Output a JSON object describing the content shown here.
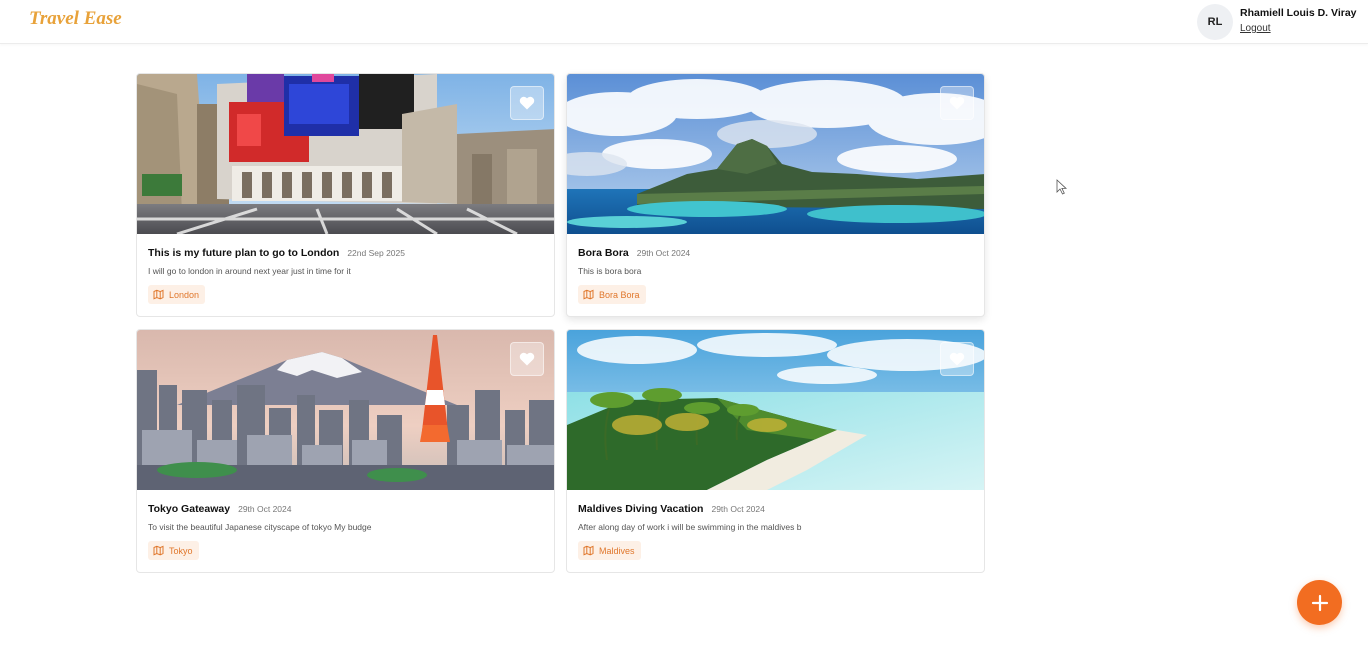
{
  "app": {
    "name": "Travel Ease"
  },
  "user": {
    "initials": "RL",
    "name": "Rhamiell Louis D. Viray",
    "logout_label": "Logout"
  },
  "stories": [
    {
      "title": "This is my future plan to go to London",
      "date": "22nd Sep 2025",
      "description": "I will go to london in around next year just in time for it",
      "location": "London",
      "image_icon": "london-street-photo"
    },
    {
      "title": "Bora Bora",
      "date": "29th Oct 2024",
      "description": "This is bora bora",
      "location": "Bora Bora",
      "image_icon": "bora-bora-island-photo"
    },
    {
      "title": "Tokyo Gateaway",
      "date": "29th Oct 2024",
      "description": "To visit the beautiful Japanese cityscape of tokyo My budge",
      "location": "Tokyo",
      "image_icon": "tokyo-skyline-photo"
    },
    {
      "title": "Maldives Diving Vacation",
      "date": "29th Oct 2024",
      "description": "After along day of work i will be swimming in the maldives b",
      "location": "Maldives",
      "image_icon": "maldives-beach-photo"
    }
  ],
  "actions": {
    "add_icon": "plus-icon",
    "favorite_icon": "heart-icon",
    "location_icon": "map-icon"
  },
  "colors": {
    "brand": "#e8a23a",
    "accent": "#f26d21",
    "tag_bg": "#fdf0e6",
    "tag_text": "#e0772c"
  }
}
